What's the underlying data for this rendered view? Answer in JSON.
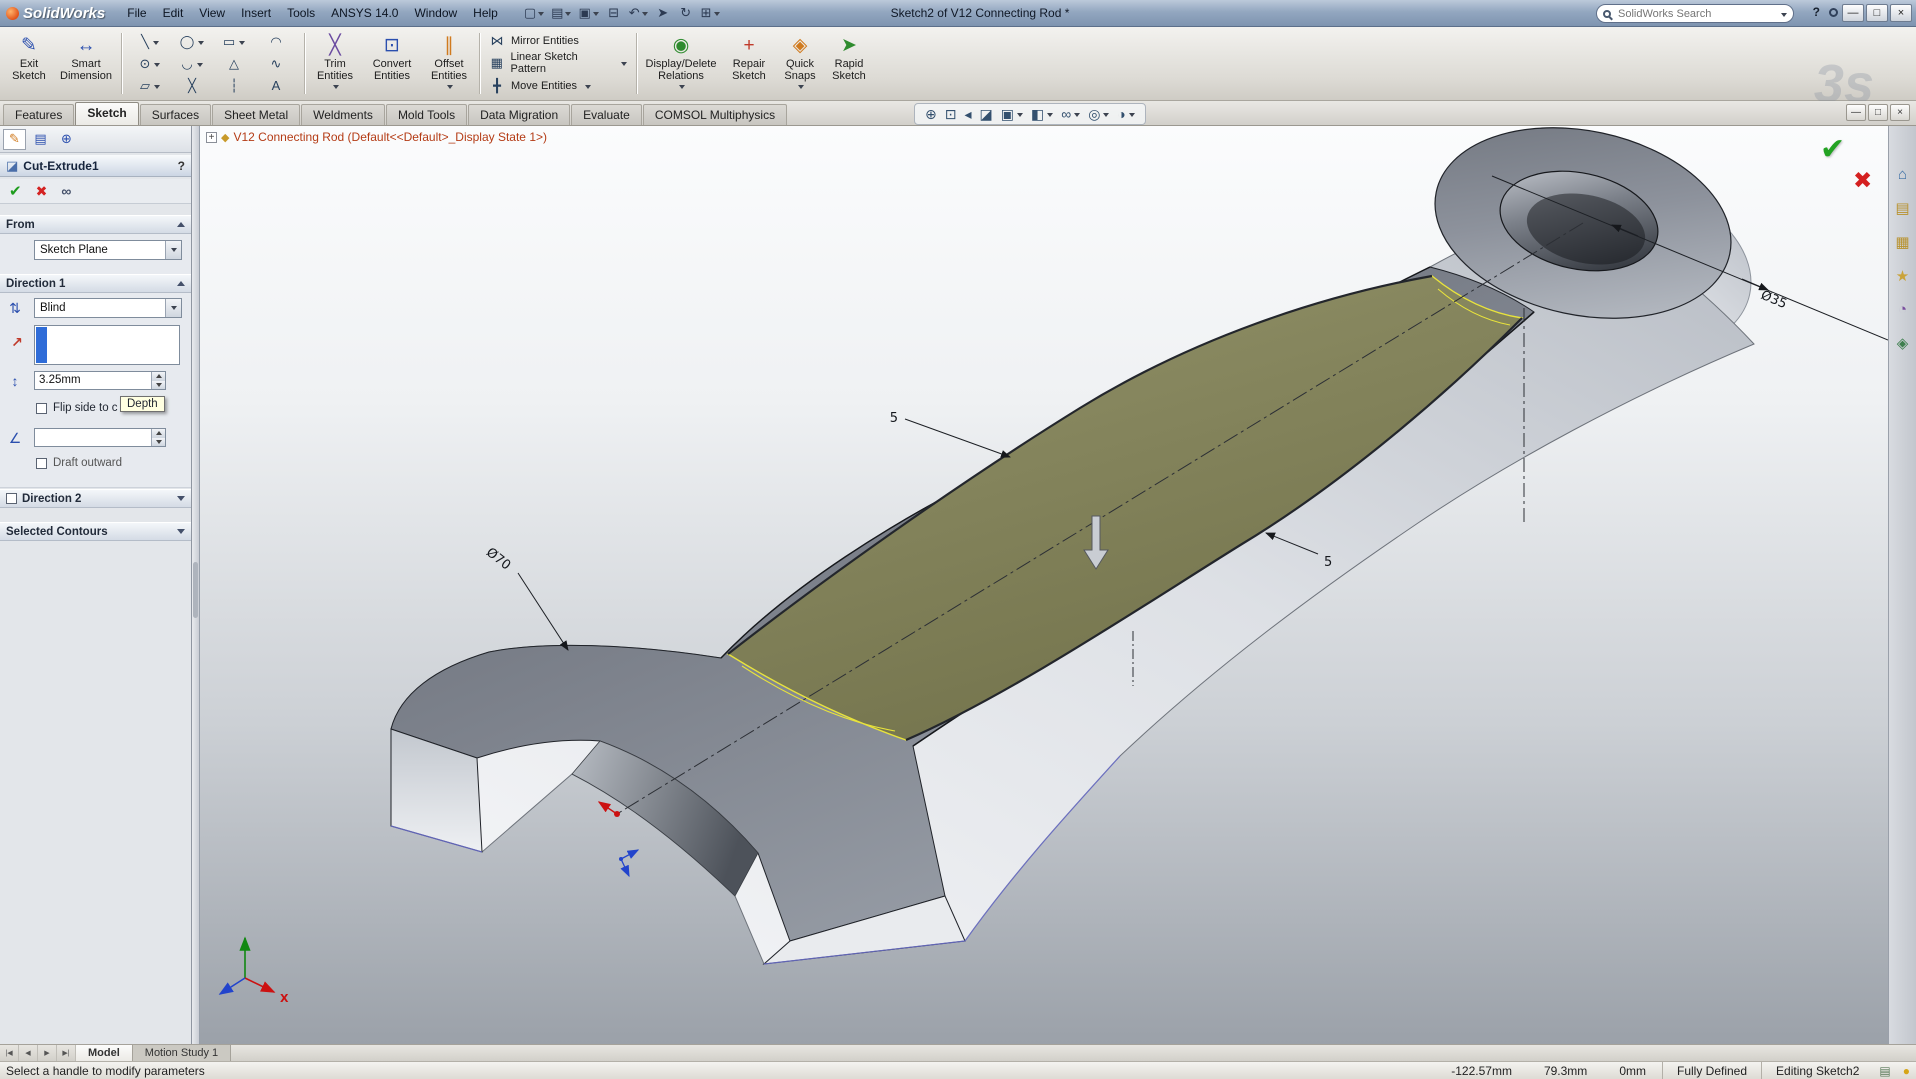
{
  "titlebar": {
    "logo": "SolidWorks",
    "menus": [
      "File",
      "Edit",
      "View",
      "Insert",
      "Tools",
      "ANSYS 14.0",
      "Window",
      "Help"
    ],
    "doc_title": "Sketch2 of V12 Connecting Rod *",
    "search_placeholder": "SolidWorks Search"
  },
  "ribbon": {
    "exit": "Exit Sketch",
    "smart": "Smart Dimension",
    "trim": "Trim Entities",
    "convert": "Convert Entities",
    "offset": "Offset Entities",
    "mirror": "Mirror Entities",
    "linear": "Linear Sketch Pattern",
    "move": "Move Entities",
    "relations": "Display/Delete Relations",
    "repair": "Repair Sketch",
    "quick": "Quick Snaps",
    "rapid": "Rapid Sketch"
  },
  "tabs": {
    "items": [
      "Features",
      "Sketch",
      "Surfaces",
      "Sheet Metal",
      "Weldments",
      "Mold Tools",
      "Data Migration",
      "Evaluate",
      "COMSOL Multiphysics"
    ],
    "active": "Sketch"
  },
  "property_manager": {
    "title": "Cut-Extrude1",
    "help": "?",
    "from_label": "From",
    "from_value": "Sketch Plane",
    "dir1_label": "Direction 1",
    "end_condition": "Blind",
    "depth_value": "3.25mm",
    "depth_tooltip": "Depth",
    "flip_label": "Flip side to c",
    "draft_value": "",
    "draft_outward_label": "Draft outward",
    "dir2_label": "Direction 2",
    "contours_label": "Selected Contours"
  },
  "feature_tree": {
    "root": "V12 Connecting Rod (Default<<Default>_Display State 1>)"
  },
  "viewport": {
    "dims": {
      "d35": "Ø35",
      "d70": "Ø70",
      "d5a": "5",
      "d5b": "5"
    },
    "triad": {
      "x": "X"
    }
  },
  "bottom": {
    "tabs": [
      "Model",
      "Motion Study 1"
    ],
    "active": "Model"
  },
  "statusbar": {
    "message": "Select a handle to modify parameters",
    "x": "-122.57mm",
    "y": "79.3mm",
    "z": "0mm",
    "state": "Fully Defined",
    "editing": "Editing Sketch2"
  },
  "icons": {
    "qat": [
      "▢",
      "▤",
      "▣",
      "⊟",
      "↶",
      "➤",
      "↻",
      "⊞"
    ],
    "sketch_grid": [
      "╲",
      "◯",
      "▭",
      "◠",
      "⊙",
      "◡",
      "△",
      "∿",
      "▱",
      "╳",
      "┆",
      "A"
    ],
    "exit_sketch": "✎",
    "smart_dimension": "↔",
    "trim": "╳",
    "convert": "⊡",
    "offset": "∥",
    "mirror": "⋈",
    "linear": "▦",
    "move": "╋",
    "relations": "◉",
    "repair": "+",
    "quick_snaps": "◈",
    "rapid": "➤",
    "headsup": [
      "⊕",
      "⊡",
      "◂",
      "◪",
      "▣",
      "◧",
      "∞",
      "◎",
      "◑"
    ],
    "pm_tabs": [
      "✎",
      "▤",
      "⊕"
    ],
    "pm_feature": "◪",
    "ok": "✔",
    "cancel": "✖",
    "preview": "∞",
    "ref_arrow": "↗",
    "reverse": "⇅",
    "depth": "↕",
    "draft": "∠",
    "help": "?",
    "win_min": "—",
    "win_max": "□",
    "win_close": "×",
    "nav": [
      "|◀",
      "◀",
      "▶",
      "▶|"
    ],
    "strip": [
      "⌂",
      "▤",
      "▦",
      "★",
      "◔",
      "◈"
    ],
    "status_flag": "▤",
    "status_ball": "●",
    "plus": "+",
    "part": "◆",
    "watermark": "3s"
  }
}
